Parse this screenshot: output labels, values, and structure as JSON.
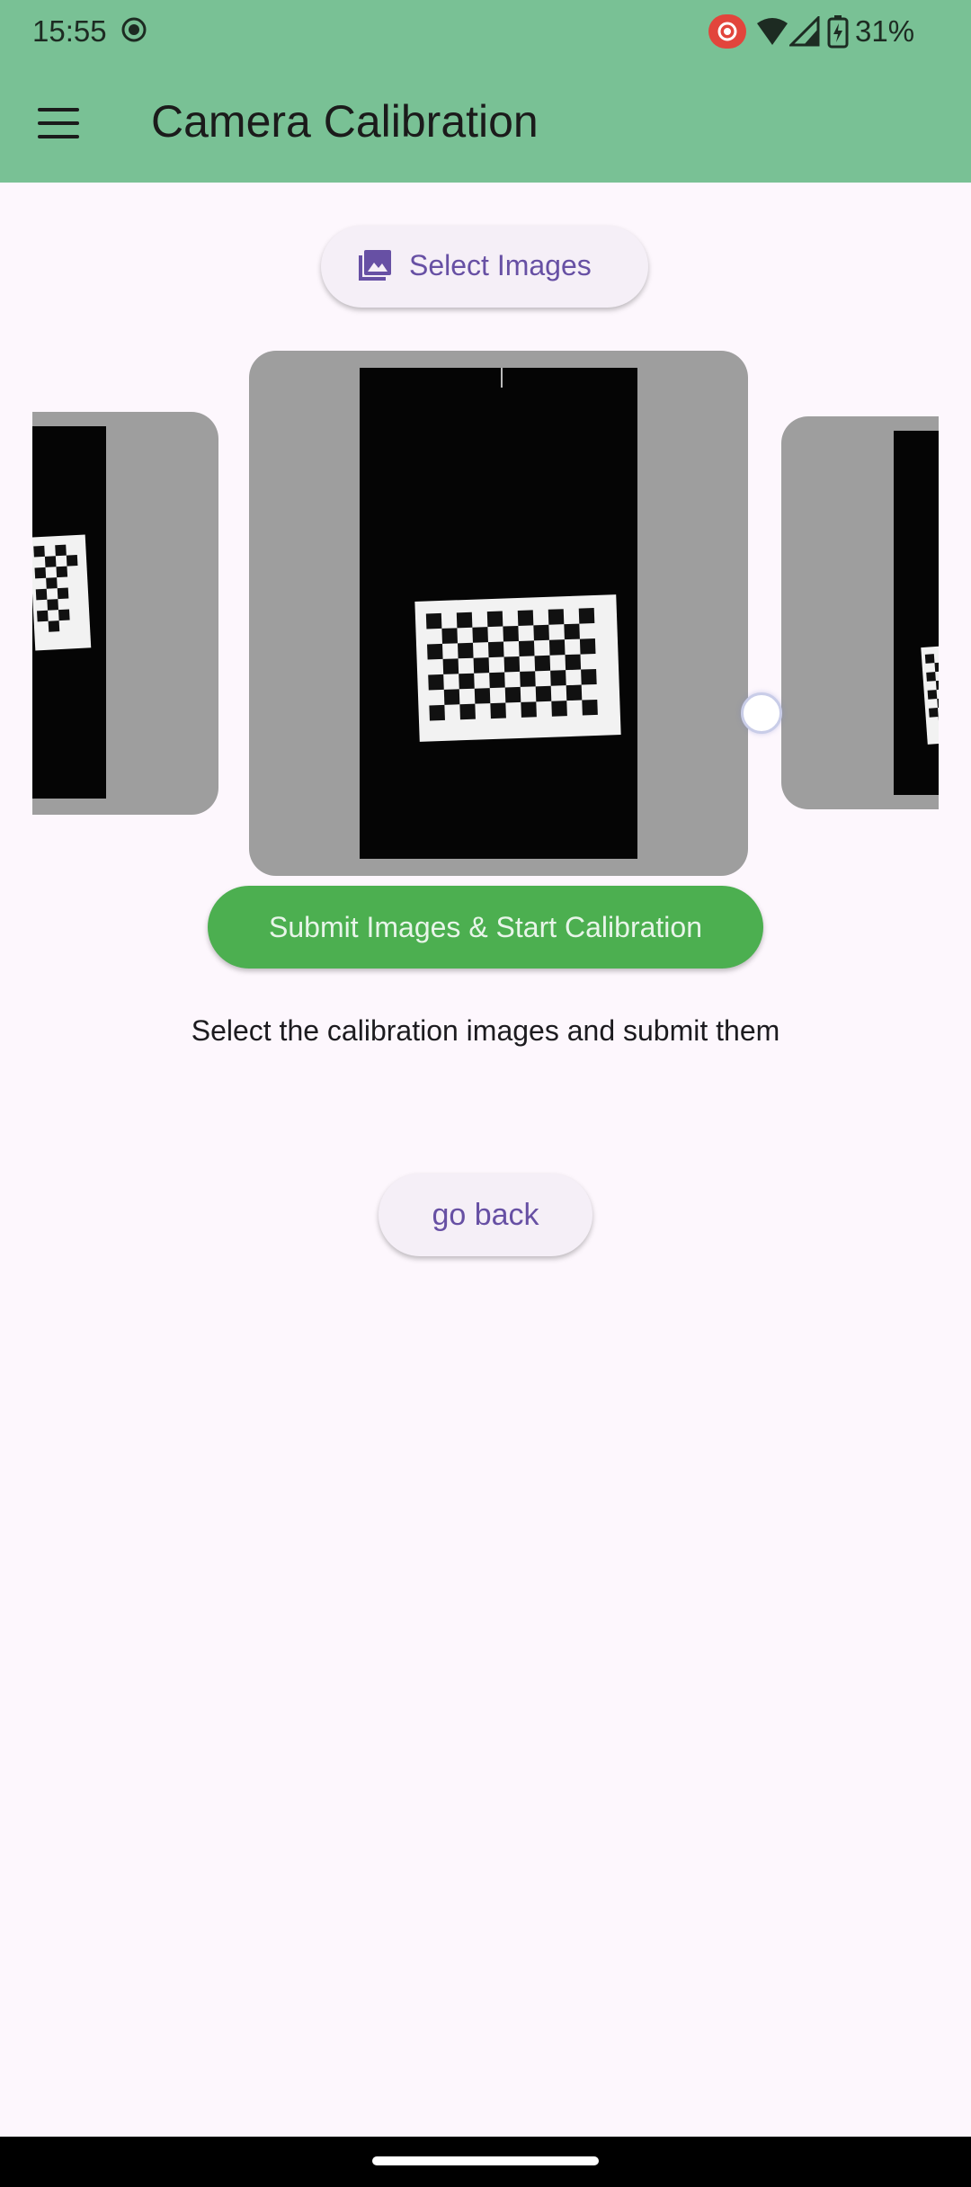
{
  "status_bar": {
    "time": "15:55",
    "battery_percent": "31%",
    "icons": [
      "screen-record-icon",
      "cast-icon",
      "wifi-icon",
      "signal-icon",
      "battery-icon"
    ]
  },
  "app_bar": {
    "title": "Camera Calibration",
    "menu_icon": "hamburger-menu-icon",
    "background": "#79c195"
  },
  "actions": {
    "select_images_label": "Select Images",
    "select_images_icon": "image-icon",
    "submit_label": "Submit Images & Start Calibration",
    "go_back_label": "go back"
  },
  "carousel": {
    "items": [
      {
        "name": "calibration-image-previous",
        "icon": "checkerboard-photo"
      },
      {
        "name": "calibration-image-current",
        "icon": "checkerboard-photo"
      },
      {
        "name": "calibration-image-next",
        "icon": "checkerboard-photo"
      }
    ]
  },
  "hint_text": "Select the calibration images and submit them",
  "colors": {
    "accent": "#6750a4",
    "submit": "#4caf50",
    "page_background": "#fdf7fd"
  }
}
